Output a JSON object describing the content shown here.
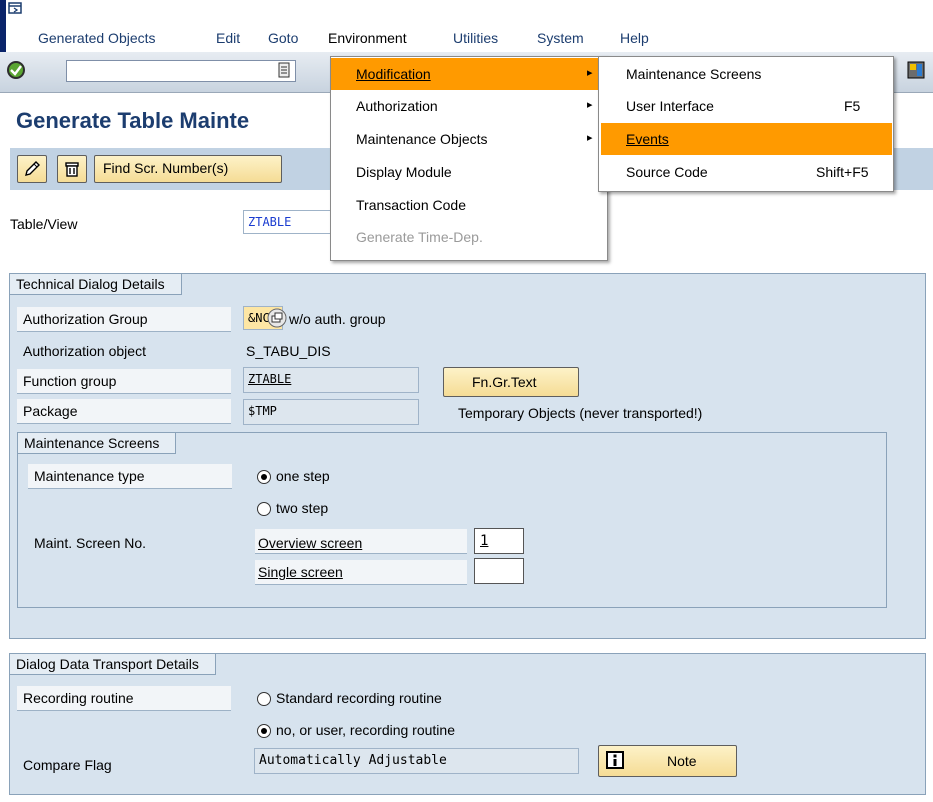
{
  "menubar": {
    "items": [
      "Generated Objects",
      "Edit",
      "Goto",
      "Environment",
      "Utilities",
      "System",
      "Help"
    ]
  },
  "title": "Generate Table Mainte",
  "apptoolbar": {
    "find_label": "Find Scr. Number(s)"
  },
  "tableview": {
    "label": "Table/View",
    "value": "ZTABLE"
  },
  "technical": {
    "title": "Technical Dialog Details",
    "auth_group_label": "Authorization Group",
    "auth_group_value": "&NC&",
    "auth_group_hint": "w/o auth. group",
    "auth_obj_label": "Authorization object",
    "auth_obj_value": "S_TABU_DIS",
    "func_group_label": "Function group",
    "func_group_value": "ZTABLE",
    "fn_text_button": "Fn.Gr.Text",
    "package_label": "Package",
    "package_value": "$TMP",
    "package_desc": "Temporary Objects (never transported!)"
  },
  "maint_screens": {
    "title": "Maintenance Screens",
    "type_label": "Maintenance type",
    "one_step": "one step",
    "two_step": "two step",
    "screen_no_label": "Maint. Screen No.",
    "overview_label": "Overview screen",
    "overview_value": "1",
    "single_label": "Single screen",
    "single_value": ""
  },
  "transport": {
    "title": "Dialog Data Transport Details",
    "recording_label": "Recording routine",
    "standard": "Standard recording routine",
    "no_user": "no, or user, recording routine",
    "compare_label": "Compare Flag",
    "compare_value": "Automatically Adjustable",
    "note_button": "Note"
  },
  "env_menu": {
    "items": [
      "Modification",
      "Authorization",
      "Maintenance Objects",
      "Display Module",
      "Transaction Code",
      "Generate Time-Dep."
    ]
  },
  "mod_submenu": {
    "items": [
      {
        "label": "Maintenance Screens",
        "shortcut": ""
      },
      {
        "label": "User Interface",
        "shortcut": "F5"
      },
      {
        "label": "Events",
        "shortcut": ""
      },
      {
        "label": "Source Code",
        "shortcut": "Shift+F5"
      }
    ]
  },
  "colors": {
    "highlight": "#ff9a00",
    "brand_blue": "#1c3d6f"
  }
}
